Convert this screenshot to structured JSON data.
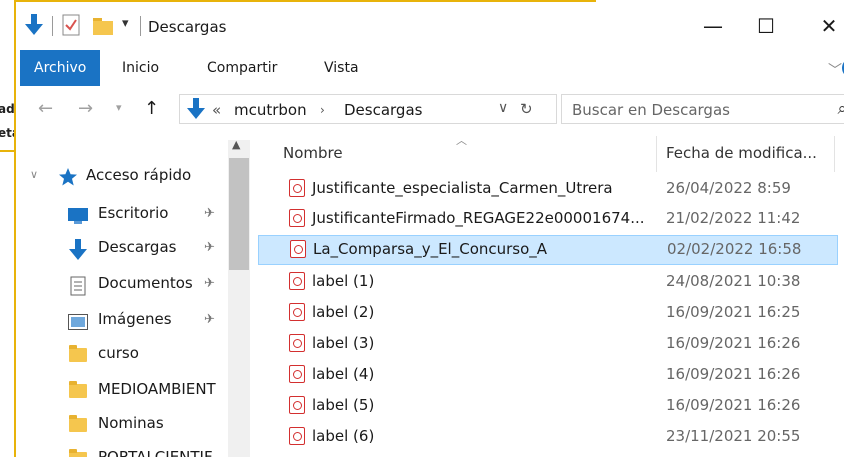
{
  "background_window": {
    "snippet_1": "ad",
    "snippet_2": "eta"
  },
  "window": {
    "title": "Descargas",
    "minimize_glyph": "—",
    "maximize_glyph": "☐",
    "close_glyph": "✕"
  },
  "ribbon": {
    "tabs": [
      "Archivo",
      "Inicio",
      "Compartir",
      "Vista"
    ],
    "active": "Archivo"
  },
  "address": {
    "overflow": "«",
    "segments": [
      "mcutrbon",
      "Descargas"
    ]
  },
  "search": {
    "placeholder": "Buscar en Descargas"
  },
  "nav_pane": {
    "items": [
      {
        "label": "Acceso rápido",
        "icon": "star-icon",
        "pinned": false
      },
      {
        "label": "Escritorio",
        "icon": "desktop-icon",
        "pinned": true
      },
      {
        "label": "Descargas",
        "icon": "download-arrow-icon",
        "pinned": true
      },
      {
        "label": "Documentos",
        "icon": "document-icon",
        "pinned": true
      },
      {
        "label": "Imágenes",
        "icon": "pictures-icon",
        "pinned": true
      },
      {
        "label": "curso",
        "icon": "folder-icon",
        "pinned": false
      },
      {
        "label": "MEDIOAMBIENT",
        "icon": "folder-icon",
        "pinned": false
      },
      {
        "label": "Nominas",
        "icon": "folder-icon",
        "pinned": false
      },
      {
        "label": "PORTALCIENTIF",
        "icon": "folder-icon",
        "pinned": false
      }
    ]
  },
  "columns": {
    "name": "Nombre",
    "date": "Fecha de modifica..."
  },
  "files": [
    {
      "name": "Justificante_especialista_Carmen_Utrera",
      "date": "26/04/2022 8:59"
    },
    {
      "name": "JustificanteFirmado_REGAGE22e00001674...",
      "date": "21/02/2022 11:42"
    },
    {
      "name": "La_Comparsa_y_El_Concurso_A",
      "date": "02/02/2022 16:58",
      "selected": true
    },
    {
      "name": "label (1)",
      "date": "24/08/2021 10:38"
    },
    {
      "name": "label (2)",
      "date": "16/09/2021 16:25"
    },
    {
      "name": "label (3)",
      "date": "16/09/2021 16:26"
    },
    {
      "name": "label (4)",
      "date": "16/09/2021 16:26"
    },
    {
      "name": "label (5)",
      "date": "16/09/2021 16:26"
    },
    {
      "name": "label (6)",
      "date": "23/11/2021 20:55"
    }
  ],
  "colors": {
    "accent": "#1a73c4",
    "selection": "#cce8ff",
    "selection_border": "#99d1ff",
    "folder": "#f5c64e",
    "pdf": "#d32f2f",
    "frame": "#e8b30a"
  }
}
